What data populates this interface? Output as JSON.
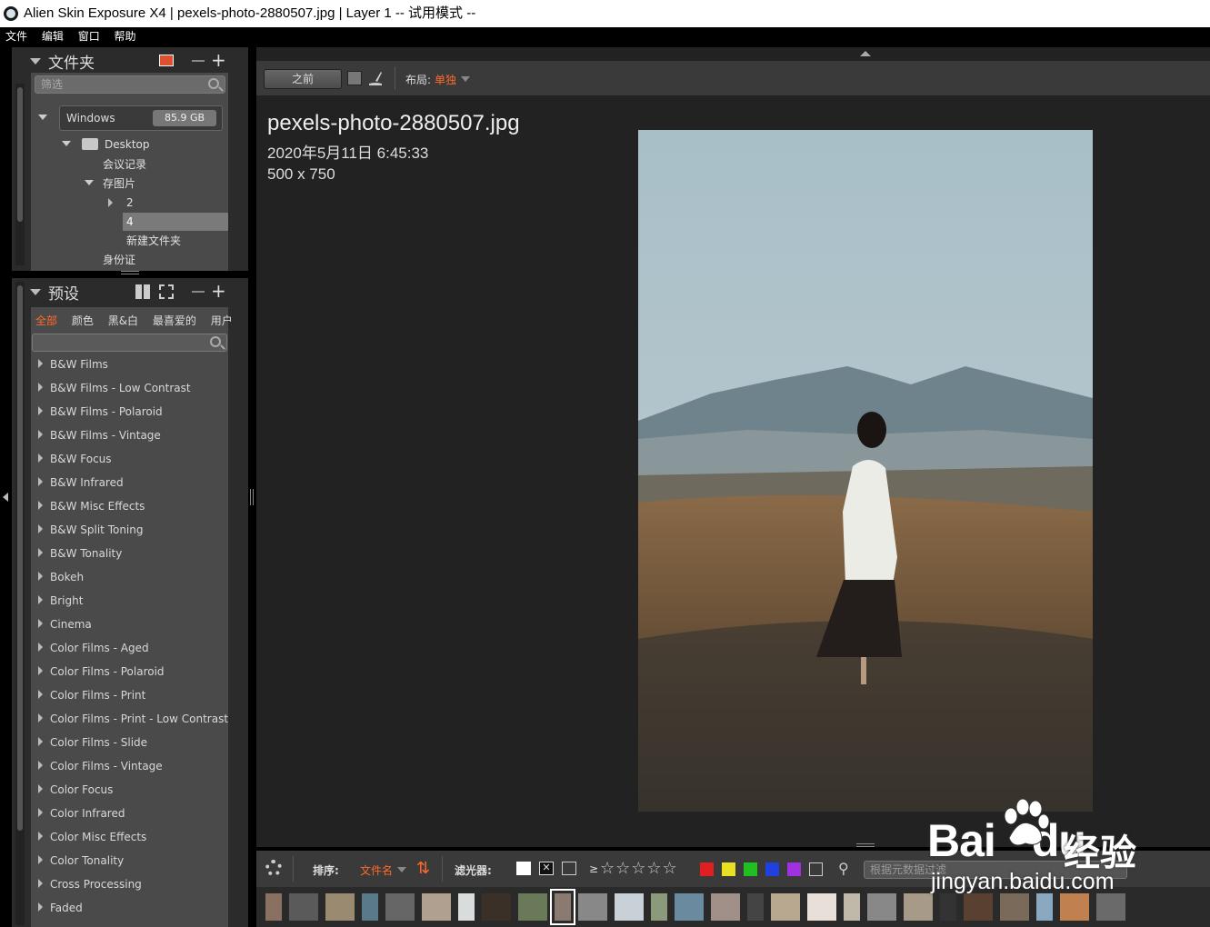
{
  "window": {
    "title": "Alien Skin Exposure X4 | pexels-photo-2880507.jpg | Layer 1 -- 试用模式 --"
  },
  "menu": [
    "文件",
    "编辑",
    "窗口",
    "帮助"
  ],
  "folders": {
    "title": "文件夹",
    "filter_placeholder": "筛选",
    "drive": {
      "name": "Windows",
      "size": "85.9 GB"
    },
    "tree": [
      {
        "label": "Desktop",
        "level": 1,
        "expanded": true
      },
      {
        "label": "会议记录",
        "level": 2
      },
      {
        "label": "存图片",
        "level": 2,
        "expanded": true
      },
      {
        "label": "2",
        "level": 3,
        "collapsed": true
      },
      {
        "label": "4",
        "level": 3,
        "selected": true
      },
      {
        "label": "新建文件夹",
        "level": 3
      },
      {
        "label": "身份证",
        "level": 2
      }
    ]
  },
  "presets": {
    "title": "预设",
    "tabs": [
      "全部",
      "颜色",
      "黑&白",
      "最喜爱的",
      "用户"
    ],
    "active_tab": "全部",
    "items": [
      "B&W Films",
      "B&W Films - Low Contrast",
      "B&W Films - Polaroid",
      "B&W Films - Vintage",
      "B&W Focus",
      "B&W Infrared",
      "B&W Misc Effects",
      "B&W Split Toning",
      "B&W Tonality",
      "Bokeh",
      "Bright",
      "Cinema",
      "Color Films - Aged",
      "Color Films - Polaroid",
      "Color Films - Print",
      "Color Films - Print - Low Contrast",
      "Color Films - Slide",
      "Color Films - Vintage",
      "Color Focus",
      "Color Infrared",
      "Color Misc Effects",
      "Color Tonality",
      "Cross Processing",
      "Faded"
    ]
  },
  "viewer": {
    "before_label": "之前",
    "layout_label": "布局:",
    "layout_value": "单独",
    "filename": "pexels-photo-2880507.jpg",
    "datetime": "2020年5月11日 6:45:33",
    "dimensions": "500 x 750"
  },
  "bottom": {
    "sort_label": "排序:",
    "sort_value": "文件名",
    "filter_label": "滤光器:",
    "rating_label": "≥",
    "metadata_placeholder": "根据元数据过滤",
    "color_labels": [
      "#e02020",
      "#e8e020",
      "#20c020",
      "#2040e0",
      "#a030e0"
    ]
  },
  "watermark": {
    "brand": "Bai",
    "brand2": "du",
    "cn": "经验",
    "url": "jingyan.baidu.com"
  },
  "accent": "#ff6a2a"
}
